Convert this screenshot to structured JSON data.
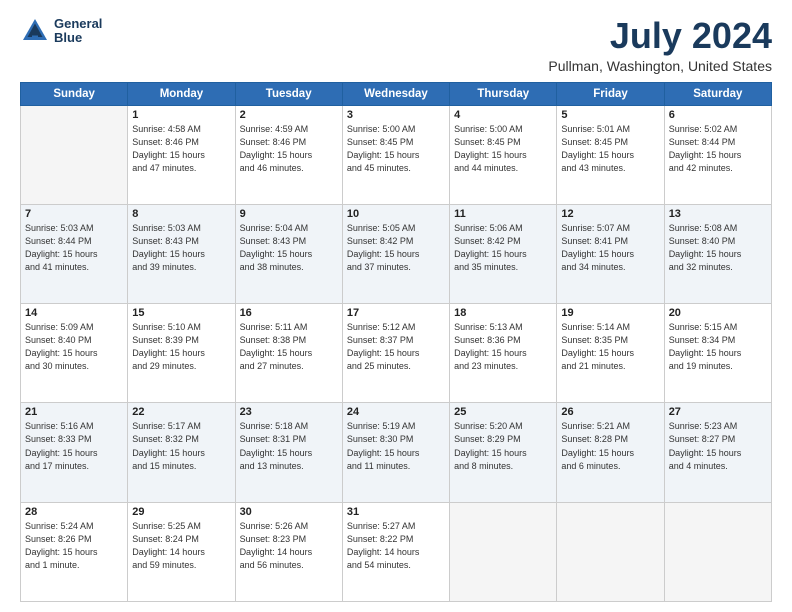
{
  "header": {
    "logo_line1": "General",
    "logo_line2": "Blue",
    "month": "July 2024",
    "location": "Pullman, Washington, United States"
  },
  "days_of_week": [
    "Sunday",
    "Monday",
    "Tuesday",
    "Wednesday",
    "Thursday",
    "Friday",
    "Saturday"
  ],
  "weeks": [
    [
      {
        "day": "",
        "info": ""
      },
      {
        "day": "1",
        "info": "Sunrise: 4:58 AM\nSunset: 8:46 PM\nDaylight: 15 hours\nand 47 minutes."
      },
      {
        "day": "2",
        "info": "Sunrise: 4:59 AM\nSunset: 8:46 PM\nDaylight: 15 hours\nand 46 minutes."
      },
      {
        "day": "3",
        "info": "Sunrise: 5:00 AM\nSunset: 8:45 PM\nDaylight: 15 hours\nand 45 minutes."
      },
      {
        "day": "4",
        "info": "Sunrise: 5:00 AM\nSunset: 8:45 PM\nDaylight: 15 hours\nand 44 minutes."
      },
      {
        "day": "5",
        "info": "Sunrise: 5:01 AM\nSunset: 8:45 PM\nDaylight: 15 hours\nand 43 minutes."
      },
      {
        "day": "6",
        "info": "Sunrise: 5:02 AM\nSunset: 8:44 PM\nDaylight: 15 hours\nand 42 minutes."
      }
    ],
    [
      {
        "day": "7",
        "info": "Sunrise: 5:03 AM\nSunset: 8:44 PM\nDaylight: 15 hours\nand 41 minutes."
      },
      {
        "day": "8",
        "info": "Sunrise: 5:03 AM\nSunset: 8:43 PM\nDaylight: 15 hours\nand 39 minutes."
      },
      {
        "day": "9",
        "info": "Sunrise: 5:04 AM\nSunset: 8:43 PM\nDaylight: 15 hours\nand 38 minutes."
      },
      {
        "day": "10",
        "info": "Sunrise: 5:05 AM\nSunset: 8:42 PM\nDaylight: 15 hours\nand 37 minutes."
      },
      {
        "day": "11",
        "info": "Sunrise: 5:06 AM\nSunset: 8:42 PM\nDaylight: 15 hours\nand 35 minutes."
      },
      {
        "day": "12",
        "info": "Sunrise: 5:07 AM\nSunset: 8:41 PM\nDaylight: 15 hours\nand 34 minutes."
      },
      {
        "day": "13",
        "info": "Sunrise: 5:08 AM\nSunset: 8:40 PM\nDaylight: 15 hours\nand 32 minutes."
      }
    ],
    [
      {
        "day": "14",
        "info": "Sunrise: 5:09 AM\nSunset: 8:40 PM\nDaylight: 15 hours\nand 30 minutes."
      },
      {
        "day": "15",
        "info": "Sunrise: 5:10 AM\nSunset: 8:39 PM\nDaylight: 15 hours\nand 29 minutes."
      },
      {
        "day": "16",
        "info": "Sunrise: 5:11 AM\nSunset: 8:38 PM\nDaylight: 15 hours\nand 27 minutes."
      },
      {
        "day": "17",
        "info": "Sunrise: 5:12 AM\nSunset: 8:37 PM\nDaylight: 15 hours\nand 25 minutes."
      },
      {
        "day": "18",
        "info": "Sunrise: 5:13 AM\nSunset: 8:36 PM\nDaylight: 15 hours\nand 23 minutes."
      },
      {
        "day": "19",
        "info": "Sunrise: 5:14 AM\nSunset: 8:35 PM\nDaylight: 15 hours\nand 21 minutes."
      },
      {
        "day": "20",
        "info": "Sunrise: 5:15 AM\nSunset: 8:34 PM\nDaylight: 15 hours\nand 19 minutes."
      }
    ],
    [
      {
        "day": "21",
        "info": "Sunrise: 5:16 AM\nSunset: 8:33 PM\nDaylight: 15 hours\nand 17 minutes."
      },
      {
        "day": "22",
        "info": "Sunrise: 5:17 AM\nSunset: 8:32 PM\nDaylight: 15 hours\nand 15 minutes."
      },
      {
        "day": "23",
        "info": "Sunrise: 5:18 AM\nSunset: 8:31 PM\nDaylight: 15 hours\nand 13 minutes."
      },
      {
        "day": "24",
        "info": "Sunrise: 5:19 AM\nSunset: 8:30 PM\nDaylight: 15 hours\nand 11 minutes."
      },
      {
        "day": "25",
        "info": "Sunrise: 5:20 AM\nSunset: 8:29 PM\nDaylight: 15 hours\nand 8 minutes."
      },
      {
        "day": "26",
        "info": "Sunrise: 5:21 AM\nSunset: 8:28 PM\nDaylight: 15 hours\nand 6 minutes."
      },
      {
        "day": "27",
        "info": "Sunrise: 5:23 AM\nSunset: 8:27 PM\nDaylight: 15 hours\nand 4 minutes."
      }
    ],
    [
      {
        "day": "28",
        "info": "Sunrise: 5:24 AM\nSunset: 8:26 PM\nDaylight: 15 hours\nand 1 minute."
      },
      {
        "day": "29",
        "info": "Sunrise: 5:25 AM\nSunset: 8:24 PM\nDaylight: 14 hours\nand 59 minutes."
      },
      {
        "day": "30",
        "info": "Sunrise: 5:26 AM\nSunset: 8:23 PM\nDaylight: 14 hours\nand 56 minutes."
      },
      {
        "day": "31",
        "info": "Sunrise: 5:27 AM\nSunset: 8:22 PM\nDaylight: 14 hours\nand 54 minutes."
      },
      {
        "day": "",
        "info": ""
      },
      {
        "day": "",
        "info": ""
      },
      {
        "day": "",
        "info": ""
      }
    ]
  ]
}
